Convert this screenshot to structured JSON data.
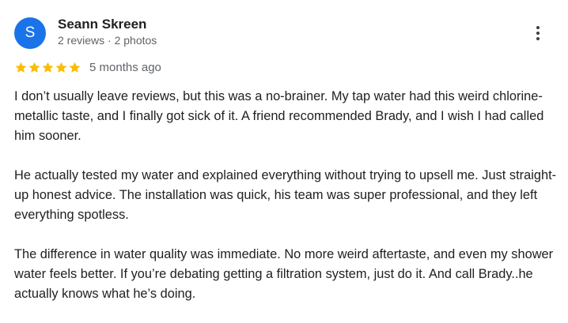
{
  "reviewer": {
    "avatar_letter": "S",
    "avatar_color": "#1a73e8",
    "name": "Seann Skreen",
    "meta": "2 reviews · 2 photos"
  },
  "rating": {
    "stars": 5,
    "max_stars": 5,
    "star_color": "#fbbc04",
    "date": "5 months ago"
  },
  "more_options_icon": "more-vert-icon",
  "review": {
    "paragraphs": [
      "I don’t usually leave reviews, but this was a no-brainer. My tap water had this weird chlorine-metallic taste, and I finally got sick of it. A friend recommended Brady, and I wish I had called him sooner.",
      "He actually tested my water and explained everything without trying to upsell me. Just straight-up honest advice. The installation was quick, his team was super professional, and they left everything spotless.",
      "The difference in water quality was immediate. No more weird aftertaste, and even my shower water feels better. If you’re debating getting a filtration system, just do it. And call Brady..he actually knows what he’s doing."
    ]
  }
}
